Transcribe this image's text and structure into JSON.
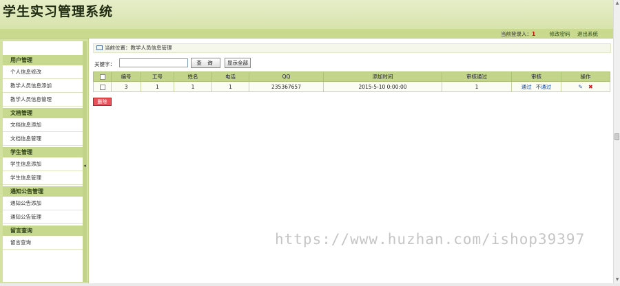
{
  "app": {
    "title": "学生实习管理系统"
  },
  "userbar": {
    "label": "当前登录人：",
    "username": "1",
    "change_password": "修改密码",
    "logout": "退出系统"
  },
  "sidebar": {
    "groups": [
      {
        "title": "用户管理",
        "items": [
          "个人信息修改",
          "教学人员信息添加",
          "教学人员信息管理"
        ]
      },
      {
        "title": "文档管理",
        "items": [
          "文档信息添加",
          "文档信息管理"
        ]
      },
      {
        "title": "学生管理",
        "items": [
          "学生信息添加",
          "学生信息管理"
        ]
      },
      {
        "title": "通知公告管理",
        "items": [
          "通知公告添加",
          "通知公告管理"
        ]
      },
      {
        "title": "留言查询",
        "items": [
          "留言查询"
        ]
      }
    ]
  },
  "breadcrumb": {
    "text": "当前位置：教学人员信息管理"
  },
  "search": {
    "label": "关键字：",
    "value": "",
    "query_button": "查 询",
    "show_all_button": "显示全部"
  },
  "table": {
    "headers": [
      "",
      "编号",
      "工号",
      "姓名",
      "电话",
      "QQ",
      "添加时间",
      "审核通过",
      "审核",
      "操作"
    ],
    "rows": [
      {
        "id": "3",
        "job_no": "1",
        "name": "1",
        "phone": "1",
        "qq": "235367657",
        "added": "2015-5-10 0:00:00",
        "approved": "1",
        "approve_link": "通过",
        "reject_link": "不通过"
      }
    ]
  },
  "actions": {
    "delete_button": "删除"
  },
  "watermark": "https://www.huzhan.com/ishop39397",
  "colors": {
    "header_bg": "#d7e3ac",
    "sidebar_header": "#c6d98e",
    "table_header": "#c3d58a",
    "delete": "#e8505a",
    "link": "#0645ad"
  }
}
